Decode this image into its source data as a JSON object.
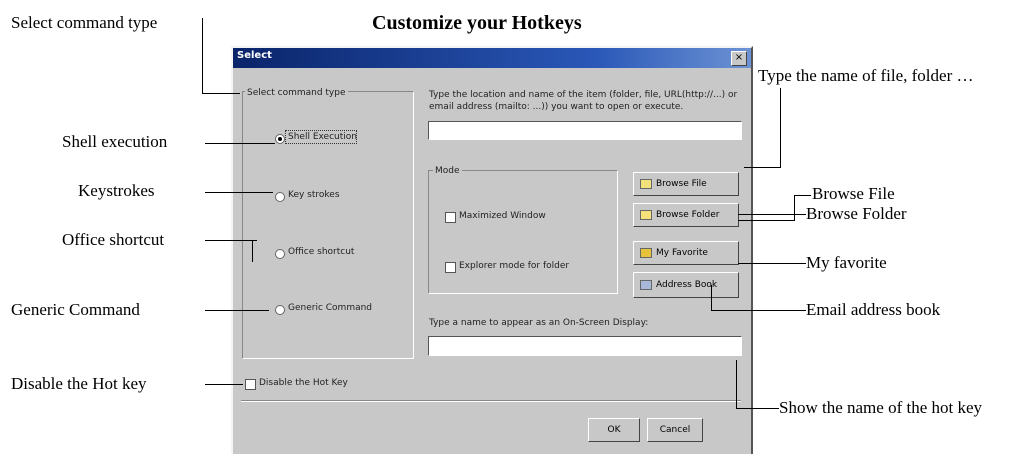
{
  "heading": "Customize your Hotkeys",
  "callouts": {
    "select_command_type": "Select command type",
    "shell_execution": "Shell execution",
    "keystrokes": "Keystrokes",
    "office_shortcut": "Office shortcut",
    "generic_command": "Generic Command",
    "disable_hot_key": "Disable the Hot key",
    "type_name": "Type the name of file, folder …",
    "browse_file": "Browse File",
    "browse_folder": "Browse Folder",
    "my_favorite": "My favorite",
    "email_address_book": "Email address book",
    "show_name": "Show the name of the hot key"
  },
  "dialog": {
    "title": "Select",
    "close": "×",
    "group_label": "Select command type",
    "options": [
      "Shell Execution",
      "Key strokes",
      "Office shortcut",
      "Generic Command"
    ],
    "selected_option": "Shell Execution",
    "location_prompt_1": "Type the location and name of the item (folder, file, URL(http://...) or",
    "location_prompt_2": "email address (mailto: ...)) you want to open or execute.",
    "location_value": "",
    "mode_label": "Mode",
    "mode_options": [
      "Maximized Window",
      "Explorer mode for folder"
    ],
    "buttons": [
      "Browse File",
      "Browse Folder",
      "My Favorite",
      "Address Book"
    ],
    "osd_prompt": "Type a name to appear as an On-Screen Display:",
    "osd_value": "",
    "disable_label": "Disable the Hot Key",
    "ok": "OK",
    "cancel": "Cancel"
  }
}
